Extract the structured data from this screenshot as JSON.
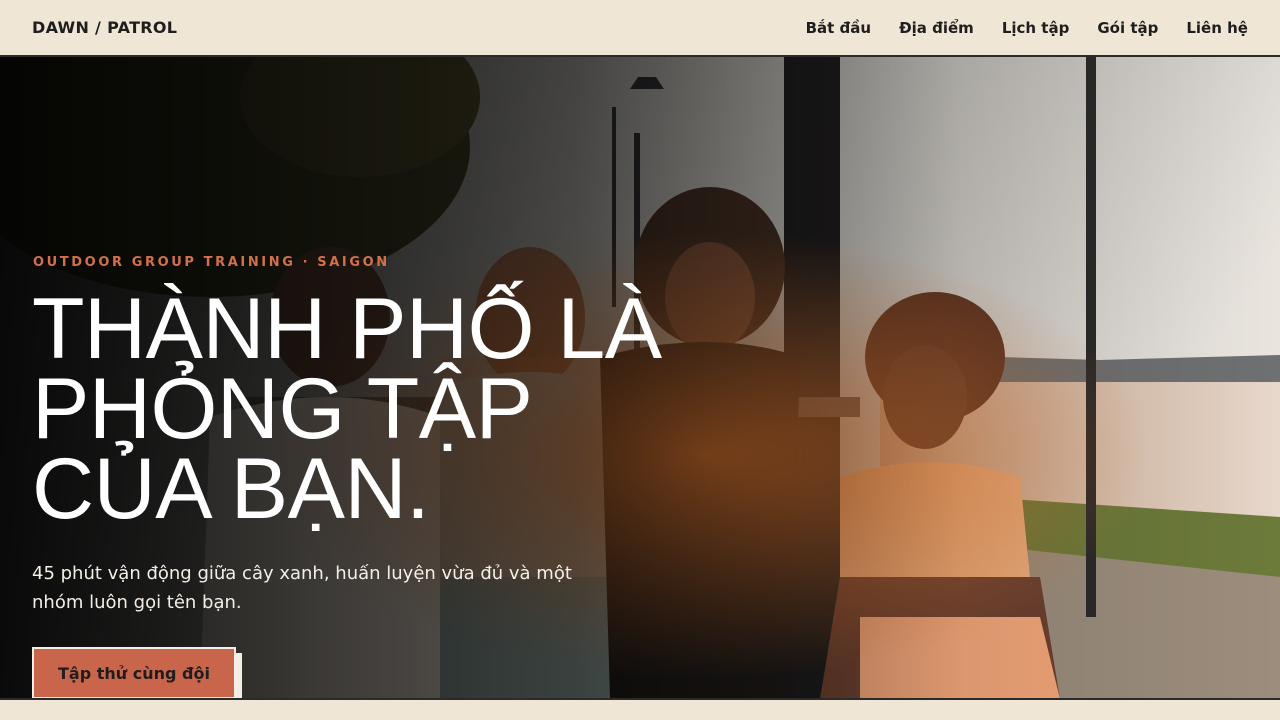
{
  "header": {
    "brand": "DAWN / PATROL",
    "nav": [
      {
        "label": "Bắt đầu"
      },
      {
        "label": "Địa điểm"
      },
      {
        "label": "Lịch tập"
      },
      {
        "label": "Gói tập"
      },
      {
        "label": "Liên hệ"
      }
    ]
  },
  "hero": {
    "eyebrow": "OUTDOOR GROUP TRAINING · SAIGON",
    "headline_lines": [
      "THÀNH PHỐ LÀ",
      "PHỎNG TẬP",
      "CỦA BẠN."
    ],
    "subtitle": "45 phút vận động giữa cây xanh, huấn luyện vừa đủ và một nhóm luôn gọi tên bạn.",
    "cta_label": "Tập thử cùng đội"
  },
  "colors": {
    "background": "#efe6d6",
    "accent": "#d3704a",
    "cta": "#c9654a",
    "text_dark": "#1e1e1e"
  }
}
